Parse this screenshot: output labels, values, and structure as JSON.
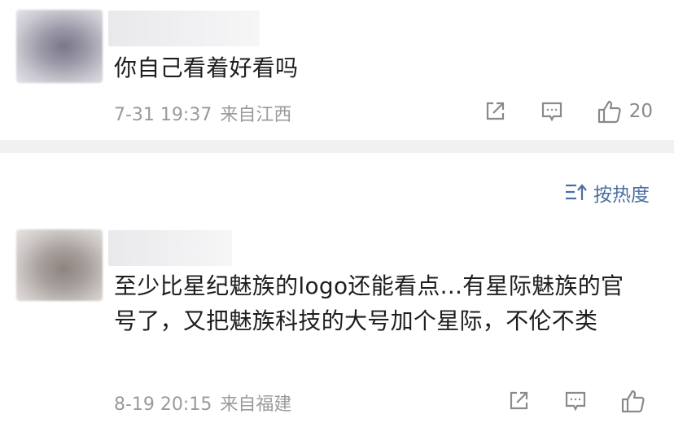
{
  "comments": [
    {
      "text": "你自己看着好看吗",
      "time": "7-31 19:37",
      "location": "来自江西",
      "likes": "20",
      "icons": {
        "share": "share-icon",
        "comment": "comment-icon",
        "like": "thumbs-up-icon"
      }
    },
    {
      "text": "至少比星纪魅族的logo还能看点...有星际魅族的官号了，又把魅族科技的大号加个星际，不伦不类",
      "time": "8-19 20:15",
      "location": "来自福建",
      "likes": "",
      "icons": {
        "share": "share-icon",
        "comment": "comment-icon",
        "like": "thumbs-up-icon"
      }
    }
  ],
  "sort": {
    "label": "按热度",
    "icon": "sort-icon"
  },
  "colors": {
    "accent": "#4a6ea0",
    "meta": "#9a9a9a",
    "divider": "#f1f1f2"
  }
}
